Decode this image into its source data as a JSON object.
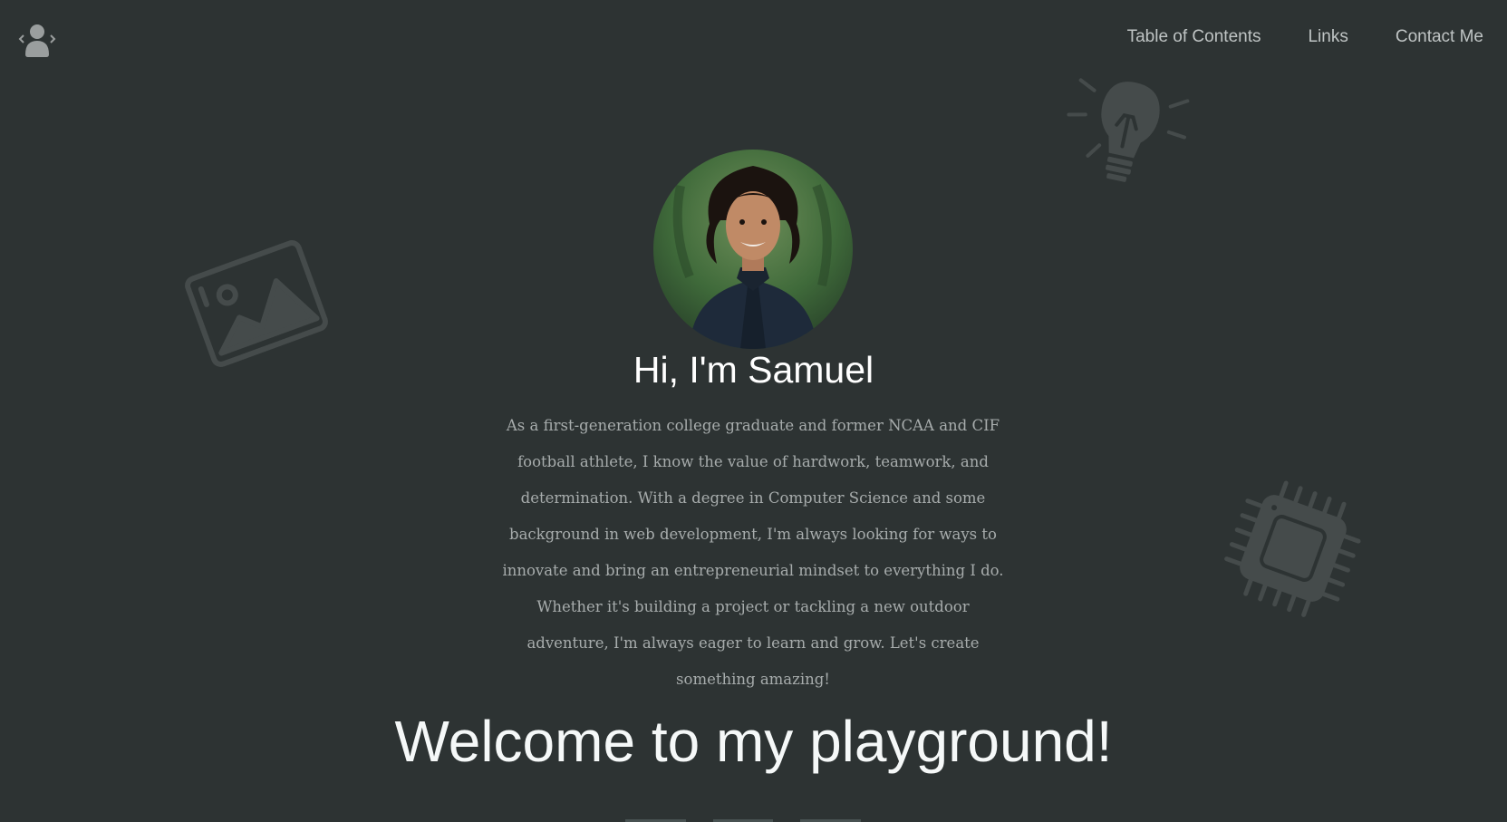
{
  "nav": {
    "logo_icon": "coder-avatar-icon",
    "items": [
      {
        "label": "Table of Contents"
      },
      {
        "label": "Links"
      },
      {
        "label": "Contact Me"
      }
    ]
  },
  "hero": {
    "title": "Hi, I'm Samuel",
    "bio": "As a first-generation college graduate and former NCAA and CIF football athlete, I know the value of hardwork, teamwork, and determination. With a degree in Computer Science and some background in web development, I'm always looking for ways to innovate and bring an entrepreneurial mindset to everything I do. Whether it's building a project or tackling a new outdoor adventure, I'm always eager to learn and grow. Let's create something amazing!"
  },
  "section": {
    "title": "Welcome to my playground!"
  },
  "decorations": {
    "icons": [
      "image-icon",
      "lightbulb-icon",
      "chip-icon"
    ]
  },
  "colors": {
    "background": "#2d3333",
    "nav_text": "#bfc4c4",
    "heading": "#ffffff",
    "body_text": "#a7acac",
    "decoration": "#454b4b"
  }
}
